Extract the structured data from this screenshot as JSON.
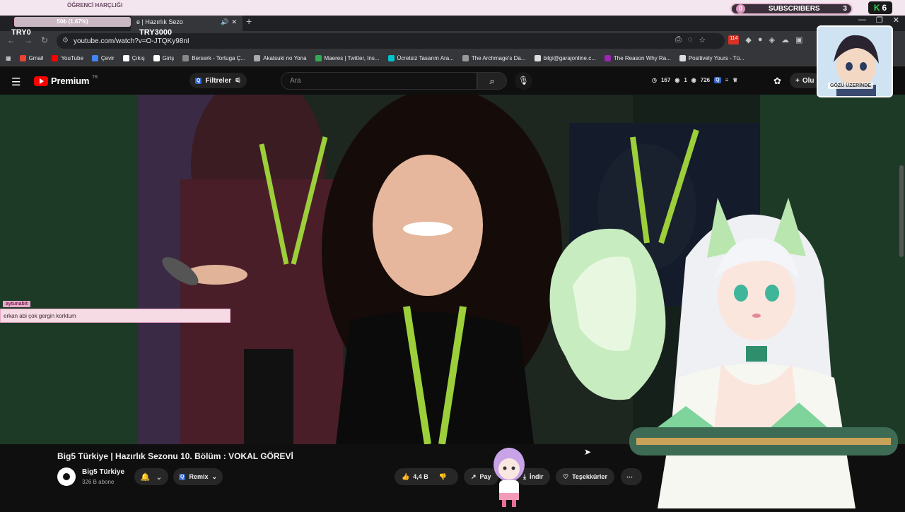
{
  "overlay": {
    "goal_title": "ÖĞRENCİ HARÇLIĞI",
    "goal_progress_text": "50₺ (1.67%)",
    "goal_progress_pct": 1.67,
    "try_left": "TRY0",
    "try_right": "TRY3000",
    "subs_count_left": "0",
    "subs_label": "SUBSCRIBERS",
    "subs_count_right": "3",
    "k_value": "6",
    "chat_username": "aytunabit",
    "chat_message": "erkan abi çok gergin korktum",
    "facecam_caption": "GÖZÜ ÜZERİNDE"
  },
  "browser": {
    "tab_title": "e | Hazırlık Sezo",
    "url": "youtube.com/watch?v=O-JTQKy98nI",
    "ext_badge": "114",
    "bookmarks": [
      {
        "label": "Gmail",
        "color": "#ea4335"
      },
      {
        "label": "YouTube",
        "color": "#ff0000"
      },
      {
        "label": "Çevir",
        "color": "#4285f4"
      },
      {
        "label": "Çıkış",
        "color": "#ffffff"
      },
      {
        "label": "Giriş",
        "color": "#ffffff"
      },
      {
        "label": "Berserk - Tortuga Ç...",
        "color": "#888888"
      },
      {
        "label": "Akatsuki no Yona",
        "color": "#aaaaaa"
      },
      {
        "label": "Maeres | Twitter, Ins...",
        "color": "#34a853"
      },
      {
        "label": "Ücretsiz Tasarım Ara...",
        "color": "#00c4cc"
      },
      {
        "label": "The Archmage's Da...",
        "color": "#999999"
      },
      {
        "label": "bilgi@garajonline.c...",
        "color": "#dddddd"
      },
      {
        "label": "The Reason Why Ra...",
        "color": "#9c27b0"
      },
      {
        "label": "Positively Yours - Tü...",
        "color": "#dddddd"
      }
    ]
  },
  "youtube": {
    "logo_text": "Premium",
    "region": "TR",
    "filters_label": "Filtreler",
    "search_placeholder": "Ara",
    "stats": [
      "167",
      "1",
      "726"
    ],
    "create_label": "Olu",
    "video_title": "Big5 Türkiye | Hazırlık Sezonu 10. Bölüm : VOKAL GÖREVİ",
    "channel_name": "Big5 Türkiye",
    "channel_subs": "326 B abone",
    "remix_label": "Remix",
    "like_count": "4,4 B",
    "share_label": "Pay",
    "download_label": "İndir",
    "thanks_label": "Teşekkürler"
  }
}
